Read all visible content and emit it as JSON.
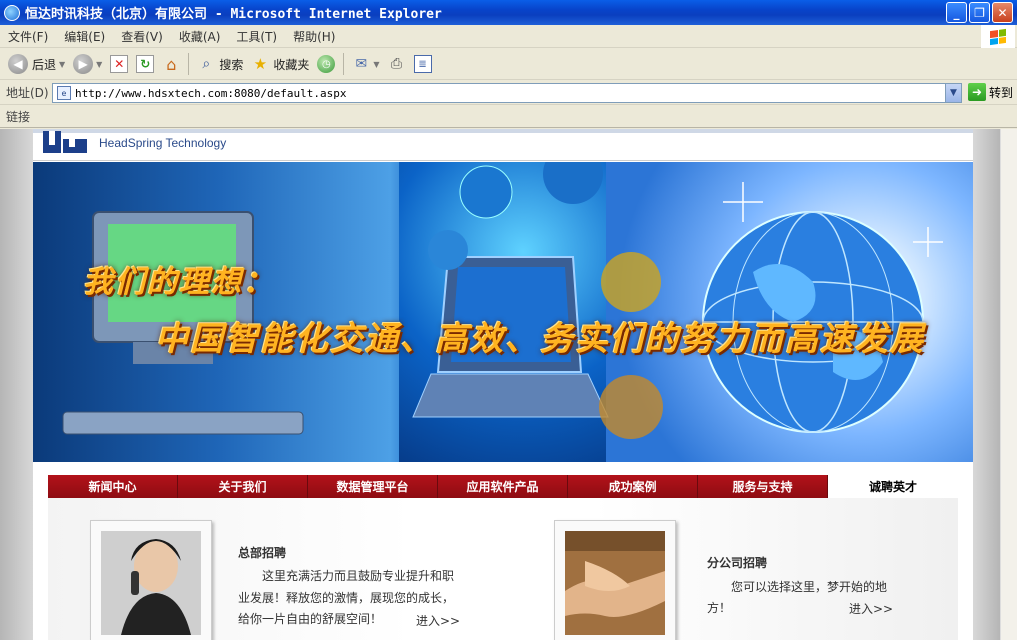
{
  "window": {
    "title": "恒达时讯科技（北京）有限公司 - Microsoft Internet Explorer",
    "min_glyph": "_",
    "max_glyph": "❐",
    "close_glyph": "✕"
  },
  "menu": [
    "文件(F)",
    "编辑(E)",
    "查看(V)",
    "收藏(A)",
    "工具(T)",
    "帮助(H)"
  ],
  "toolbar": {
    "back_label": "后退",
    "search_label": "搜索",
    "favorites_label": "收藏夹"
  },
  "address": {
    "label": "地址(D)",
    "url": "http://www.hdsxtech.com:8080/default.aspx",
    "go_label": "转到"
  },
  "links": {
    "label": "链接"
  },
  "colors": {
    "nav_red": "#a00f15",
    "title_blue": "#0a4fd8",
    "slogan_gold": "#ffb320"
  },
  "site": {
    "logo_text": "HeadSpring Technology",
    "slogan_line1": "我们的理想：",
    "slogan_line2": "中国智能化交通、高效、务实们的努力而高速发展",
    "nav": [
      "新闻中心",
      "关于我们",
      "数据管理平台",
      "应用软件产品",
      "成功案例",
      "服务与支持",
      "诚聘英才"
    ],
    "hq": {
      "title": "总部招聘",
      "line1": "这里充满活力而且鼓励专业提升和职",
      "line2": "业发展！释放您的激情，展现您的成长，",
      "line3": "给你一片自由的舒展空间！",
      "enter": "进入>>"
    },
    "branch": {
      "title": "分公司招聘",
      "line1": "您可以选择这里，梦开始的地",
      "line2": "方！",
      "enter": "进入>>"
    }
  }
}
